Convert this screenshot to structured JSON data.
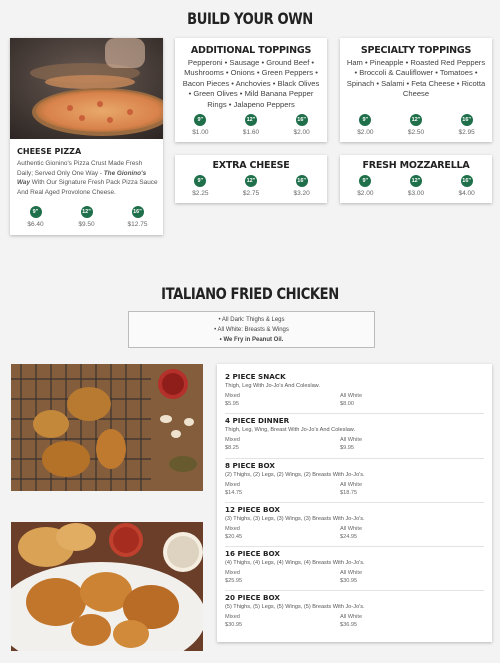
{
  "build": {
    "heading": "BUILD YOUR OWN",
    "cheese_pizza": {
      "title": "CHEESE PIZZA",
      "desc_a": "Authentic Gionino's Pizza Crust Made Fresh Daily; Served Only One Way - ",
      "desc_em": "The Gionino's Way",
      "desc_b": " With Our Signature Fresh Pack Pizza Sauce And Real Aged Provolone Cheese.",
      "sizes": [
        "9\"",
        "12\"",
        "16\""
      ],
      "prices": [
        "$6.40",
        "$9.50",
        "$12.75"
      ]
    },
    "additional": {
      "title": "ADDITIONAL TOPPINGS",
      "body": "Pepperoni • Sausage • Ground Beef • Mushrooms • Onions • Green Peppers • Bacon Pieces • Anchovies • Black Olives • Green Olives • Mild Banana Pepper Rings • Jalapeno Peppers",
      "sizes": [
        "9\"",
        "12\"",
        "16\""
      ],
      "prices": [
        "$1.00",
        "$1.60",
        "$2.00"
      ]
    },
    "specialty": {
      "title": "SPECIALTY TOPPINGS",
      "body": "Ham • Pineapple • Roasted Red Peppers • Broccoli & Cauliflower • Tomatoes • Spinach • Salami • Feta Cheese • Ricotta Cheese",
      "sizes": [
        "9\"",
        "12\"",
        "16\""
      ],
      "prices": [
        "$2.00",
        "$2.50",
        "$2.95"
      ]
    },
    "extra_cheese": {
      "title": "EXTRA CHEESE",
      "sizes": [
        "9\"",
        "12\"",
        "16\""
      ],
      "prices": [
        "$2.25",
        "$2.75",
        "$3.20"
      ]
    },
    "fresh_mozz": {
      "title": "FRESH MOZZARELLA",
      "sizes": [
        "9\"",
        "12\"",
        "16\""
      ],
      "prices": [
        "$2.00",
        "$3.00",
        "$4.00"
      ]
    }
  },
  "chicken": {
    "heading": "ITALIANO FRIED CHICKEN",
    "info": [
      "All Dark: Thighs & Legs",
      "All White: Breasts & Wings",
      "We Fry in Peanut Oil."
    ],
    "mixed_label": "Mixed",
    "white_label": "All White",
    "items": [
      {
        "title": "2 PIECE SNACK",
        "desc": "Thigh, Leg With Jo-Jo's And Coleslaw.",
        "mixed": "$5.95",
        "white": "$8.00"
      },
      {
        "title": "4 PIECE DINNER",
        "desc": "Thigh, Leg, Wing, Breast With Jo-Jo's And Coleslaw.",
        "mixed": "$8.25",
        "white": "$9.95"
      },
      {
        "title": "8 PIECE BOX",
        "desc": "(2) Thighs, (2) Legs, (2) Wings, (2) Breasts With Jo-Jo's.",
        "mixed": "$14.75",
        "white": "$18.75"
      },
      {
        "title": "12 PIECE BOX",
        "desc": "(3) Thighs, (3) Legs, (3) Wings, (3) Breasts With Jo-Jo's.",
        "mixed": "$20.45",
        "white": "$24.95"
      },
      {
        "title": "16 PIECE BOX",
        "desc": "(4) Thighs, (4) Legs, (4) Wings, (4) Breasts With Jo-Jo's.",
        "mixed": "$25.95",
        "white": "$30.95"
      },
      {
        "title": "20 PIECE BOX",
        "desc": "(5) Thighs, (5) Legs, (5) Wings, (5) Breasts With Jo-Jo's.",
        "mixed": "$30.95",
        "white": "$36.95"
      }
    ]
  },
  "colors": {
    "badge": "#1f6f4a",
    "background": "#f3f3f3"
  }
}
